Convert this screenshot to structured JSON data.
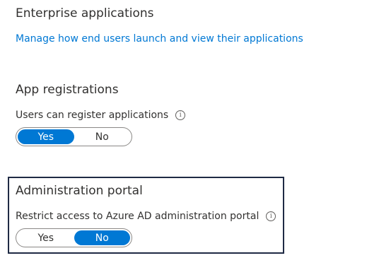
{
  "enterprise": {
    "heading": "Enterprise applications",
    "link": "Manage how end users launch and view their applications"
  },
  "app_registrations": {
    "heading": "App registrations",
    "setting_label": "Users can register applications",
    "info_icon": "info-icon",
    "options": [
      "Yes",
      "No"
    ],
    "selected": "Yes"
  },
  "admin_portal": {
    "heading": "Administration portal",
    "setting_label": "Restrict access to Azure AD administration portal",
    "info_icon": "info-icon",
    "options": [
      "Yes",
      "No"
    ],
    "selected": "No"
  },
  "colors": {
    "accent": "#0078d4",
    "highlight_border": "#1f2a44",
    "text": "#323130"
  }
}
